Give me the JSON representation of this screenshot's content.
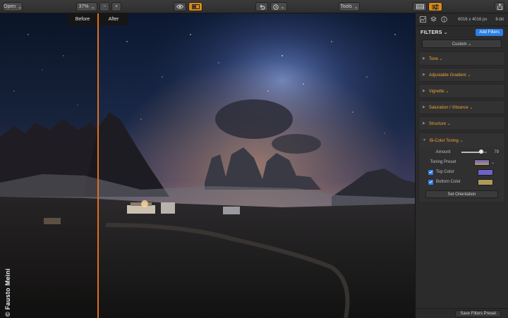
{
  "toolbar": {
    "open_label": "Open",
    "zoom_value": "37%",
    "zoom_out_label": "−",
    "zoom_in_label": "+",
    "undo_icon": "undo-icon",
    "history_icon": "history-icon",
    "tools_label": "Tools",
    "accent": "#d98a1c"
  },
  "canvas": {
    "before_label": "Before",
    "after_label": "After",
    "credit": "© Fausto Meini",
    "split_color": "#e0701e"
  },
  "panel": {
    "image_dims": "6016 x 4016 px",
    "bit_depth": "8-bit",
    "filters_title": "FILTERS",
    "filters_chevron": "⌄",
    "add_filters_label": "Add Filters",
    "preset_value": "Custom ⌄",
    "filters": [
      {
        "label": "Tone ⌄"
      },
      {
        "label": "Adjustable Gradient ⌄"
      },
      {
        "label": "Vignette ⌄"
      },
      {
        "label": "Saturation / Vibrance ⌄"
      },
      {
        "label": "Structure ⌄"
      }
    ],
    "bicolor": {
      "label": "Bi-Color Toning ⌄",
      "amount_label": "Amount",
      "amount_value": "79",
      "amount_fraction": 0.79,
      "toning_preset_label": "Toning Preset",
      "top_color_label": "Top Color",
      "bottom_color_label": "Bottom Color",
      "top_color": "#6e63c8",
      "bottom_color": "#b09a5a",
      "set_orientation_label": "Set Orientation"
    },
    "save_preset_label": "Save Filters Preset"
  }
}
